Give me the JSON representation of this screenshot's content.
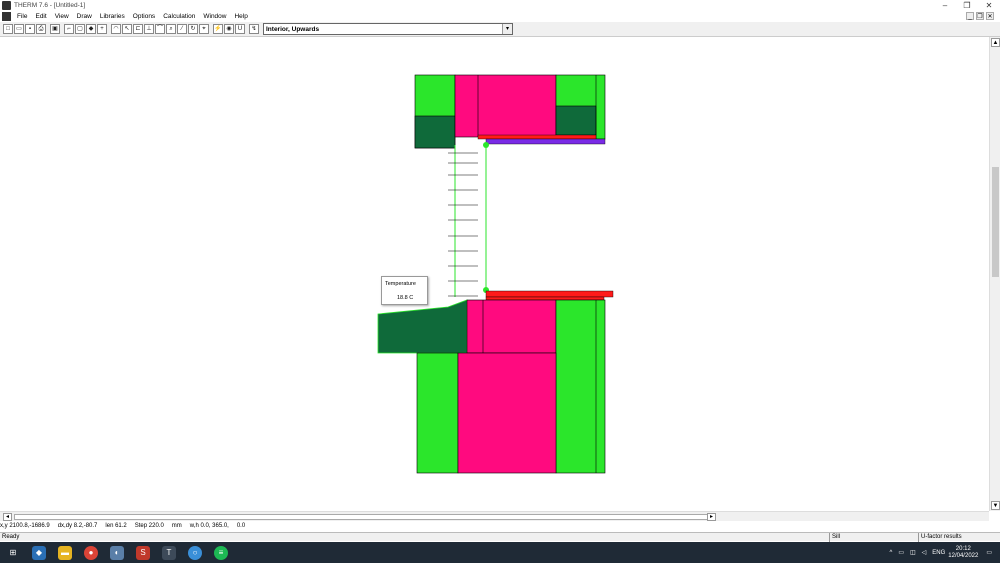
{
  "window": {
    "title": "THERM 7.6 - [Untitled-1]"
  },
  "menu": [
    "File",
    "Edit",
    "View",
    "Draw",
    "Libraries",
    "Options",
    "Calculation",
    "Window",
    "Help"
  ],
  "toolbar": {
    "result_view": "Interior, Upwards"
  },
  "tooltip": {
    "label": "Temperature",
    "value": "18.8 C"
  },
  "coords": {
    "xy": "x,y 2100.8,-1686.9",
    "dxdy": "dx,dy  8.2,-80.7",
    "len": "len  61.2",
    "step": "Step 220.0",
    "units": "mm",
    "wh": "w,h  0.0, 365.0,",
    "extra": "0.0"
  },
  "status": {
    "ready": "Ready",
    "boundary": "Sill",
    "mode": "U-factor results"
  },
  "taskbar": {
    "lang": "ENG",
    "time": "20:12",
    "date": "12/04/2022"
  },
  "colors": {
    "insulation": "#2be62b",
    "wood": "#ff0a7f",
    "dark_wood": "#0f6a3a",
    "frame": "#ff1a1a",
    "glass_edge": "#7a2be6"
  }
}
